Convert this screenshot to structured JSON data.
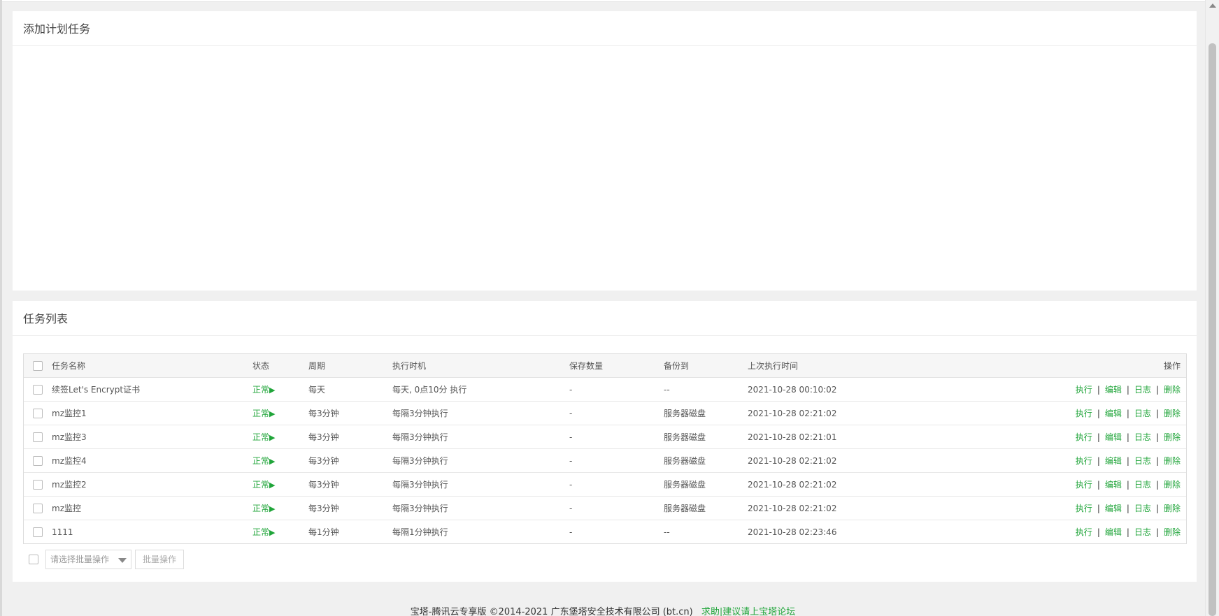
{
  "add_panel": {
    "title": "添加计划任务"
  },
  "list_panel": {
    "title": "任务列表",
    "columns": [
      "任务名称",
      "状态",
      "周期",
      "执行时机",
      "保存数量",
      "备份到",
      "上次执行时间",
      "操作"
    ],
    "rows": [
      {
        "name": "续签Let's Encrypt证书",
        "status": "正常",
        "cycle": "每天",
        "timing": "每天, 0点10分 执行",
        "keep": "-",
        "backup": "--",
        "last": "2021-10-28 00:10:02"
      },
      {
        "name": "mz监控1",
        "status": "正常",
        "cycle": "每3分钟",
        "timing": "每隔3分钟执行",
        "keep": "-",
        "backup": "服务器磁盘",
        "last": "2021-10-28 02:21:02"
      },
      {
        "name": "mz监控3",
        "status": "正常",
        "cycle": "每3分钟",
        "timing": "每隔3分钟执行",
        "keep": "-",
        "backup": "服务器磁盘",
        "last": "2021-10-28 02:21:01"
      },
      {
        "name": "mz监控4",
        "status": "正常",
        "cycle": "每3分钟",
        "timing": "每隔3分钟执行",
        "keep": "-",
        "backup": "服务器磁盘",
        "last": "2021-10-28 02:21:02"
      },
      {
        "name": "mz监控2",
        "status": "正常",
        "cycle": "每3分钟",
        "timing": "每隔3分钟执行",
        "keep": "-",
        "backup": "服务器磁盘",
        "last": "2021-10-28 02:21:02"
      },
      {
        "name": "mz监控",
        "status": "正常",
        "cycle": "每3分钟",
        "timing": "每隔3分钟执行",
        "keep": "-",
        "backup": "服务器磁盘",
        "last": "2021-10-28 02:21:02"
      },
      {
        "name": "1111",
        "status": "正常",
        "cycle": "每1分钟",
        "timing": "每隔1分钟执行",
        "keep": "-",
        "backup": "--",
        "last": "2021-10-28 02:23:46"
      }
    ],
    "ops": {
      "run": "执行",
      "edit": "编辑",
      "log": "日志",
      "delete": "删除",
      "separator": "|"
    },
    "status_marker": "▶",
    "batch": {
      "select_placeholder": "请选择批量操作",
      "button": "批量操作"
    }
  },
  "footer": {
    "copyright": "宝塔-腾讯云专享版 ©2014-2021 广东堡塔安全技术有限公司 (bt.cn)",
    "link": "求助|建议请上宝塔论坛"
  },
  "colors": {
    "accent": "#20a53a",
    "background": "#f0f0f0"
  }
}
